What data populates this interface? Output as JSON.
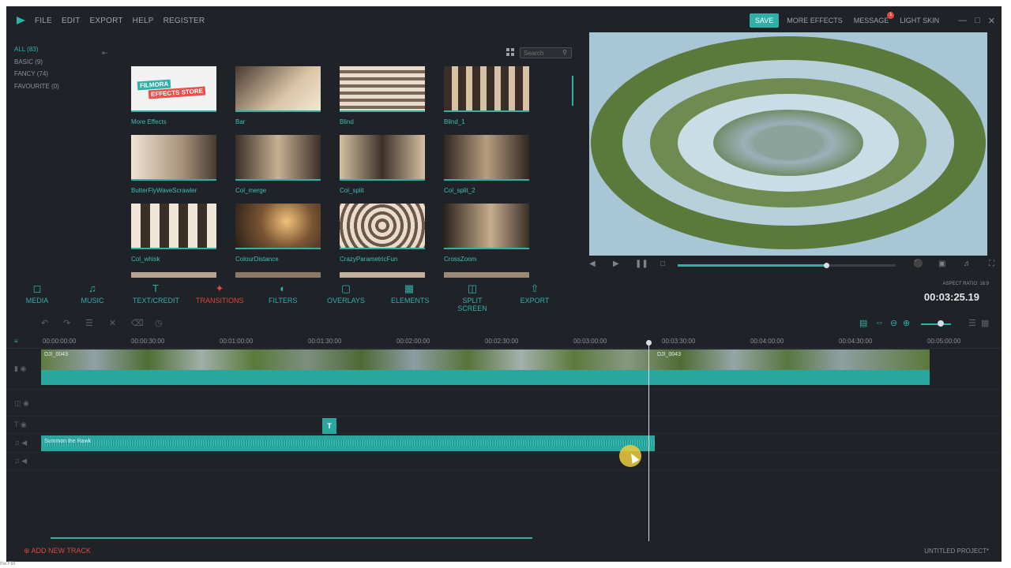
{
  "menu": {
    "items": [
      "FILE",
      "EDIT",
      "EXPORT",
      "HELP",
      "REGISTER"
    ]
  },
  "top_right": {
    "save": "SAVE",
    "more_effects": "MORE EFFECTS",
    "message": "MESSAGE",
    "badge": "1",
    "skin": "LIGHT SKIN"
  },
  "categories": [
    "ALL (83)",
    "BASIC (9)",
    "FANCY (74)",
    "FAVOURITE (0)"
  ],
  "search": {
    "placeholder": "Search"
  },
  "effects": [
    {
      "label": "More Effects",
      "store_line1": "FILMORA",
      "store_line2": "EFFECTS STORE"
    },
    {
      "label": "Bar"
    },
    {
      "label": "Blind"
    },
    {
      "label": "Blind_1"
    },
    {
      "label": "ButterFlyWaveScrawler"
    },
    {
      "label": "Col_merge"
    },
    {
      "label": "Col_split"
    },
    {
      "label": "Col_split_2"
    },
    {
      "label": "Col_whisk"
    },
    {
      "label": "ColourDistance"
    },
    {
      "label": "CrazyParametricFun"
    },
    {
      "label": "CrossZoom"
    }
  ],
  "player": {
    "progress": 0.68
  },
  "toolbar": {
    "items": [
      "MEDIA",
      "MUSIC",
      "TEXT/CREDIT",
      "TRANSITIONS",
      "FILTERS",
      "OVERLAYS",
      "ELEMENTS",
      "SPLIT SCREEN",
      "EXPORT"
    ],
    "active": "TRANSITIONS",
    "aspect": "ASPECT RATIO: 16:9",
    "timecode": "00:03:25.19"
  },
  "ruler": [
    "00:00:00:00",
    "00:00:30:00",
    "00:01:00:00",
    "00:01:30:00",
    "00:02:00:00",
    "00:02:30:00",
    "00:03:00:00",
    "00:03:30:00",
    "00:04:00:00",
    "00:04:30:00",
    "00:05:00:00"
  ],
  "clips": {
    "video_a": "DJI_0043",
    "video_b": "DJI_0043",
    "text": "T",
    "audio": "Summon the Rawk"
  },
  "footer": {
    "add_track": "ADD NEW TRACK",
    "project": "UNTITLED PROJECT*"
  },
  "corner": "the FBI"
}
